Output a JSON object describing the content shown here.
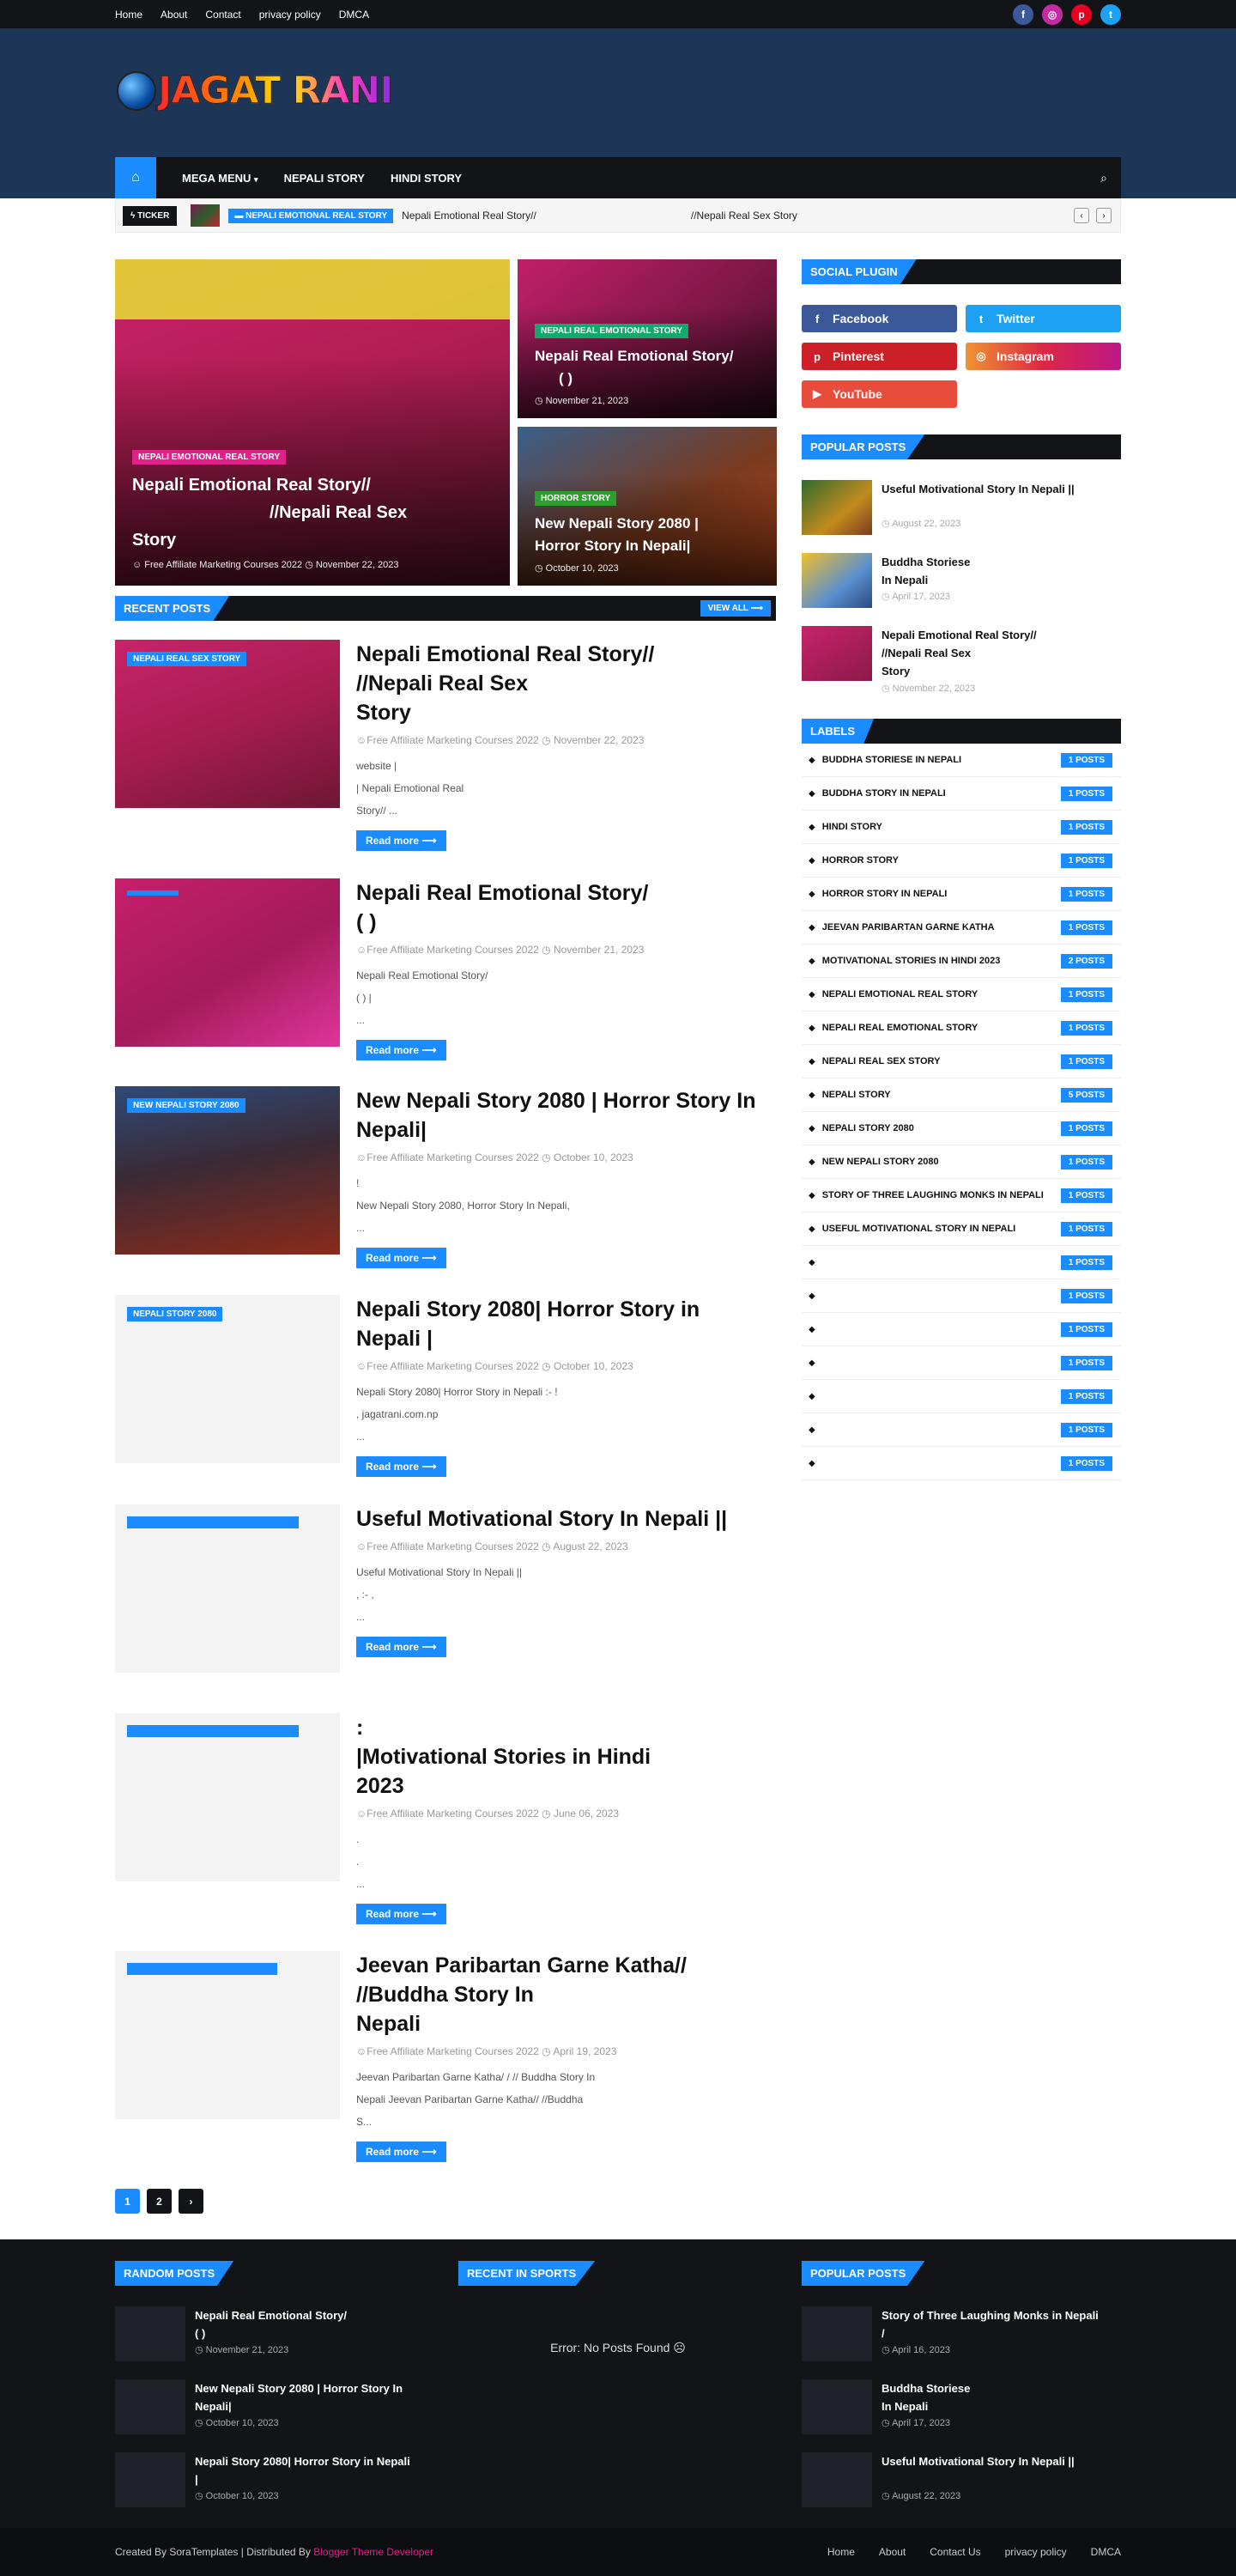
{
  "topbar": {
    "links": [
      "Home",
      "About",
      "Contact",
      "privacy policy",
      "DMCA"
    ],
    "social_icons": [
      "facebook-icon",
      "instagram-icon",
      "pinterest-icon",
      "twitter-icon"
    ]
  },
  "brand": {
    "logo_text": "JAGAT RANI"
  },
  "nav": {
    "items": [
      "MEGA MENU",
      "NEPALI STORY",
      "HINDI STORY"
    ],
    "home_icon": "home-icon",
    "search_icon": "search-icon"
  },
  "ticker": {
    "label": "TICKER",
    "tag": "NEPALI EMOTIONAL REAL STORY",
    "text_a": "Nepali Emotional Real Story//",
    "text_b": "//Nepali Real Sex Story"
  },
  "featured": [
    {
      "tag": "NEPALI EMOTIONAL REAL STORY",
      "title_a": "Nepali Emotional Real Story//",
      "title_b": "//Nepali Real Sex",
      "title_c": "Story",
      "author": "Free Affiliate Marketing Courses 2022",
      "date": "November 22, 2023"
    },
    {
      "tag": "NEPALI REAL EMOTIONAL STORY",
      "title_a": "Nepali Real Emotional Story/",
      "title_b": "(                    )",
      "date": "November 21, 2023"
    },
    {
      "tag": "HORROR STORY",
      "title_a": "New Nepali Story 2080 |",
      "title_b": "Horror Story In Nepali|",
      "date": "October 10, 2023"
    }
  ],
  "recent": {
    "heading": "Recent Posts",
    "view_all": "VIEW ALL",
    "read_more": "Read more",
    "posts": [
      {
        "tag": "NEPALI REAL SEX STORY",
        "title": "Nepali Emotional Real Story//\n                                //Nepali Real Sex\nStory",
        "author": "Free Affiliate Marketing Courses 2022",
        "date": "November 22, 2023",
        "excerpt": "                                                                         website                        |\n                                                                         |        Nepali Emotional Real\nStory//       ..."
      },
      {
        "tag": "",
        "title": "Nepali Real Emotional Story/\n                            (                 )",
        "author": "Free Affiliate Marketing Courses 2022",
        "date": "November 21, 2023",
        "excerpt": "                                                          Nepali Real Emotional Story/\n                                  (                )      |\n                       ..."
      },
      {
        "tag": "NEW NEPALI STORY 2080",
        "title": "New Nepali Story 2080 | Horror Story In\nNepali|",
        "author": "Free Affiliate Marketing Courses 2022",
        "date": "October 10, 2023",
        "excerpt": "                                      !\nNew Nepali Story 2080, Horror Story In Nepali,\n            ..."
      },
      {
        "tag": "NEPALI STORY 2080",
        "title": "Nepali Story 2080| Horror Story in\nNepali |",
        "author": "Free Affiliate Marketing Courses 2022",
        "date": "October 10, 2023",
        "excerpt": "Nepali Story 2080| Horror Story in Nepali :-                            !\n                           ,                       jagatrani.com.np\n             ..."
      },
      {
        "tag": "",
        "title": "Useful Motivational Story In Nepali ||",
        "author": "Free Affiliate Marketing Courses 2022",
        "date": "August 22, 2023",
        "excerpt": "Useful Motivational Story In Nepali ||\n             ,                                             :-               ,\n                        ..."
      },
      {
        "tag": "",
        "title": "                                    :\n          |Motivational Stories in Hindi\n2023",
        "author": "Free Affiliate Marketing Courses 2022",
        "date": "June 06, 2023",
        "excerpt": "                          .\n                                                                                                            .\n               ..."
      },
      {
        "tag": "",
        "title": "Jeevan Paribartan Garne Katha//\n                               //Buddha Story In\nNepali",
        "author": "Free Affiliate Marketing Courses 2022",
        "date": "April 19, 2023",
        "excerpt": "Jeevan Paribartan Garne Katha/ /                                    // Buddha Story In\nNepali  Jeevan Paribartan Garne Katha//                                      //Buddha\nS..."
      }
    ]
  },
  "pagination": {
    "pages": [
      "1",
      "2"
    ],
    "next": "›"
  },
  "sidebar": {
    "social_heading": "Social Plugin",
    "social": [
      "Facebook",
      "Twitter",
      "Pinterest",
      "Instagram",
      "YouTube"
    ],
    "popular_heading": "Popular Posts",
    "popular": [
      {
        "title": "Useful Motivational Story In Nepali ||",
        "date": "August 22, 2023"
      },
      {
        "title": "                                    Buddha Storiese\nIn Nepali",
        "date": "April 17, 2023"
      },
      {
        "title": "Nepali Emotional Real Story//\n                      //Nepali Real Sex\nStory",
        "date": "November 22, 2023"
      }
    ],
    "labels_heading": "Labels",
    "labels": [
      {
        "name": "BUDDHA STORIESE IN NEPALI",
        "count": "1 POSTS"
      },
      {
        "name": "BUDDHA STORY IN NEPALI",
        "count": "1 POSTS"
      },
      {
        "name": "HINDI STORY",
        "count": "1 POSTS"
      },
      {
        "name": "HORROR STORY",
        "count": "1 POSTS"
      },
      {
        "name": "HORROR STORY IN NEPALI",
        "count": "1 POSTS"
      },
      {
        "name": "JEEVAN PARIBARTAN GARNE KATHA",
        "count": "1 POSTS"
      },
      {
        "name": "MOTIVATIONAL STORIES IN HINDI 2023",
        "count": "2 POSTS"
      },
      {
        "name": "NEPALI EMOTIONAL REAL STORY",
        "count": "1 POSTS"
      },
      {
        "name": "NEPALI REAL EMOTIONAL STORY",
        "count": "1 POSTS"
      },
      {
        "name": "NEPALI REAL SEX STORY",
        "count": "1 POSTS"
      },
      {
        "name": "NEPALI STORY",
        "count": "5 POSTS"
      },
      {
        "name": "NEPALI STORY 2080",
        "count": "1 POSTS"
      },
      {
        "name": "NEW NEPALI STORY 2080",
        "count": "1 POSTS"
      },
      {
        "name": "STORY OF THREE LAUGHING MONKS IN NEPALI",
        "count": "1 POSTS"
      },
      {
        "name": "USEFUL MOTIVATIONAL STORY IN NEPALI",
        "count": "1 POSTS"
      },
      {
        "name": "",
        "count": "1 POSTS"
      },
      {
        "name": "",
        "count": "1 POSTS"
      },
      {
        "name": "",
        "count": "1 POSTS"
      },
      {
        "name": "",
        "count": "1 POSTS"
      },
      {
        "name": "",
        "count": "1 POSTS"
      },
      {
        "name": "",
        "count": "1 POSTS"
      },
      {
        "name": "",
        "count": "1 POSTS"
      }
    ]
  },
  "footer": {
    "random_heading": "Random Posts",
    "random": [
      {
        "title": "Nepali Real Emotional Story/\n                            (             )",
        "date": "November 21, 2023"
      },
      {
        "title": "New Nepali Story 2080 | Horror Story In\nNepali|",
        "date": "October 10, 2023"
      },
      {
        "title": "Nepali Story 2080| Horror Story in Nepali\n|",
        "date": "October 10, 2023"
      }
    ],
    "sports_heading": "Recent In Sports",
    "sports_error": "Error: No Posts Found ☹",
    "popular_heading": "Popular Posts",
    "popular": [
      {
        "title": "Story of Three Laughing Monks in Nepali\n/",
        "date": "April 16, 2023"
      },
      {
        "title": "                                   Buddha Storiese\nIn Nepali",
        "date": "April 17, 2023"
      },
      {
        "title": "Useful Motivational Story In Nepali ||",
        "date": "August 22, 2023"
      }
    ],
    "credit_prefix": "Created By SoraTemplates | Distributed By",
    "credit_link": "Blogger Theme Developer",
    "links": [
      "Home",
      "About",
      "Contact Us",
      "privacy policy",
      "DMCA"
    ]
  },
  "colors": {
    "accent": "#1a8cff",
    "dark": "#121418",
    "header_bg": "#1d3557"
  }
}
